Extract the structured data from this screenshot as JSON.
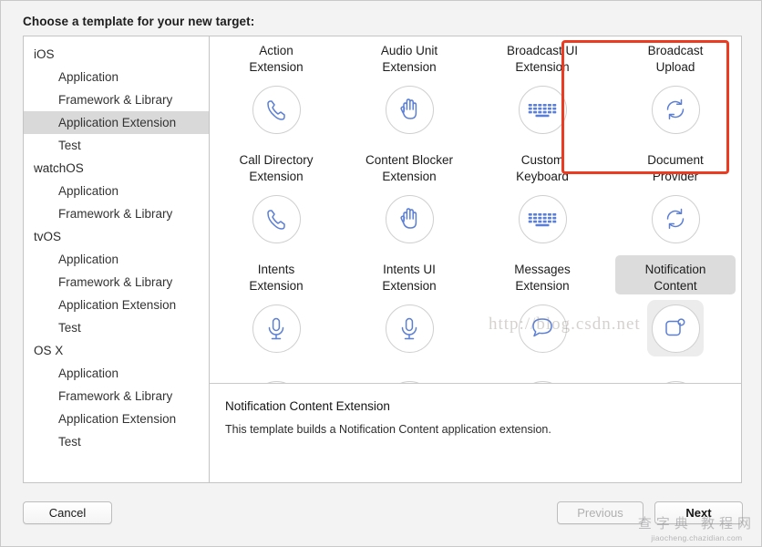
{
  "dialog": {
    "title": "Choose a template for your new target:"
  },
  "sidebar": {
    "groups": [
      {
        "name": "iOS",
        "children": [
          "Application",
          "Framework & Library",
          "Application Extension",
          "Test"
        ]
      },
      {
        "name": "watchOS",
        "children": [
          "Application",
          "Framework & Library"
        ]
      },
      {
        "name": "tvOS",
        "children": [
          "Application",
          "Framework & Library",
          "Application Extension",
          "Test"
        ]
      },
      {
        "name": "OS X",
        "children": [
          "Application",
          "Framework & Library",
          "Application Extension",
          "Test"
        ]
      }
    ],
    "selected": "Application Extension",
    "flat": [
      {
        "label": "iOS",
        "level": 0,
        "selected": false
      },
      {
        "label": "Application",
        "level": 1,
        "selected": false
      },
      {
        "label": "Framework & Library",
        "level": 1,
        "selected": false
      },
      {
        "label": "Application Extension",
        "level": 1,
        "selected": true
      },
      {
        "label": "Test",
        "level": 1,
        "selected": false
      },
      {
        "label": "watchOS",
        "level": 0,
        "selected": false
      },
      {
        "label": "Application",
        "level": 1,
        "selected": false
      },
      {
        "label": "Framework & Library",
        "level": 1,
        "selected": false
      },
      {
        "label": "tvOS",
        "level": 0,
        "selected": false
      },
      {
        "label": "Application",
        "level": 1,
        "selected": false
      },
      {
        "label": "Framework & Library",
        "level": 1,
        "selected": false
      },
      {
        "label": "Application Extension",
        "level": 1,
        "selected": false
      },
      {
        "label": "Test",
        "level": 1,
        "selected": false
      },
      {
        "label": "OS X",
        "level": 0,
        "selected": false
      },
      {
        "label": "Application",
        "level": 1,
        "selected": false
      },
      {
        "label": "Framework & Library",
        "level": 1,
        "selected": false
      },
      {
        "label": "Application Extension",
        "level": 1,
        "selected": false
      },
      {
        "label": "Test",
        "level": 1,
        "selected": false
      }
    ]
  },
  "templates": [
    {
      "label": "Action\nExtension",
      "icon": "action-icon",
      "selected": false
    },
    {
      "label": "Audio Unit\nExtension",
      "icon": "audio-unit-icon",
      "selected": false
    },
    {
      "label": "Broadcast UI\nExtension",
      "icon": "broadcast-ui-icon",
      "selected": false
    },
    {
      "label": "Broadcast\nUpload",
      "icon": "broadcast-upload-icon",
      "selected": false
    },
    {
      "label": "Call Directory\nExtension",
      "icon": "phone-icon",
      "selected": false
    },
    {
      "label": "Content Blocker\nExtension",
      "icon": "hand-icon",
      "selected": false
    },
    {
      "label": "Custom\nKeyboard",
      "icon": "keyboard-icon",
      "selected": false
    },
    {
      "label": "Document\nProvider",
      "icon": "refresh-icon",
      "selected": false
    },
    {
      "label": "Intents\nExtension",
      "icon": "microphone-icon",
      "selected": false
    },
    {
      "label": "Intents UI\nExtension",
      "icon": "microphone-icon",
      "selected": false
    },
    {
      "label": "Messages\nExtension",
      "icon": "speech-bubble-icon",
      "selected": false
    },
    {
      "label": "Notification\nContent",
      "icon": "notification-badge-icon",
      "selected": true
    },
    {
      "label": "",
      "icon": "notification-badge-icon",
      "selected": false
    },
    {
      "label": "",
      "icon": "flower-icon",
      "selected": false
    },
    {
      "label": "",
      "icon": "share-upload-icon",
      "selected": false
    },
    {
      "label": "",
      "icon": "at-sign-icon",
      "selected": false
    }
  ],
  "description": {
    "title": "Notification Content Extension",
    "body": "This template builds a Notification Content application extension."
  },
  "footer": {
    "cancel": "Cancel",
    "previous": "Previous",
    "next": "Next"
  },
  "watermarks": {
    "csdn": "http://blog.csdn.net",
    "cn": "查字典 教程网",
    "url": "jiaocheng.chazidian.com"
  },
  "colors": {
    "annotation": "#eb3b21",
    "icon_blue": "#5b7fd4",
    "selection_gray": "#d9d9d9"
  }
}
